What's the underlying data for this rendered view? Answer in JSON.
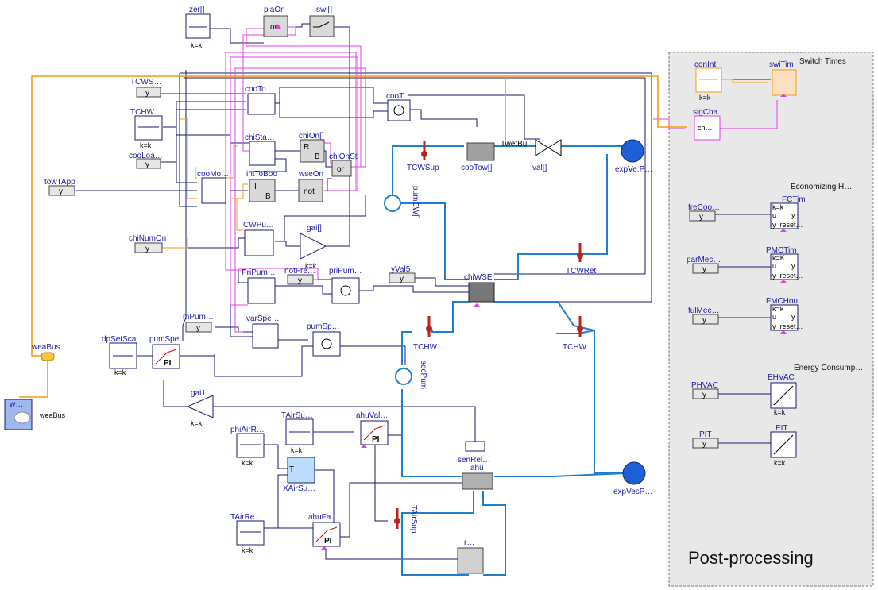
{
  "post_processing": {
    "title": "Post-processing",
    "section_switch": "Switch Times",
    "section_econ": "Economizing H…",
    "section_energy": "Energy Consump…"
  },
  "blocks": {
    "zer": {
      "name": "zer[]",
      "param": "k=k"
    },
    "plaOn": {
      "name": "plaOn",
      "inner": "or"
    },
    "swi": {
      "name": "swi[]"
    },
    "TCWS": {
      "name": "TCWS…",
      "inner": "y"
    },
    "TCHW": {
      "name": "TCHW…",
      "param": "k=k"
    },
    "cooLoa": {
      "name": "cooLoa…",
      "inner": "y"
    },
    "towTApp": {
      "name": "towTApp",
      "inner": "y"
    },
    "chiNumOn": {
      "name": "chiNumOn",
      "inner": "y"
    },
    "cooTo": {
      "name": "cooTo…"
    },
    "cooT": {
      "name": "cooT…"
    },
    "chiSta": {
      "name": "chiSta…"
    },
    "chiOn": {
      "name": "chiOn[]",
      "inner": "R",
      "inner2": "B"
    },
    "chiOnSt": {
      "name": "chiOnSt",
      "inner": "or"
    },
    "cooMo": {
      "name": "cooMo…"
    },
    "intToBoo": {
      "name": "intToBoo",
      "inner": "I",
      "inner2": "B"
    },
    "wseOn": {
      "name": "wseOn",
      "inner": "not"
    },
    "CWPu": {
      "name": "CWPu…"
    },
    "gai": {
      "name": "gai[]",
      "param": "k=k"
    },
    "PriPum": {
      "name": "PriPum…"
    },
    "notFre": {
      "name": "notFre…",
      "inner": "y"
    },
    "priPum": {
      "name": "priPum…"
    },
    "yVal5": {
      "name": "yVal5",
      "inner": "y"
    },
    "mPum": {
      "name": "mPum…",
      "inner": "y"
    },
    "varSpe": {
      "name": "varSpe…"
    },
    "pumSp": {
      "name": "pumSp…"
    },
    "dpSetSca": {
      "name": "dpSetSca",
      "param": "k=k"
    },
    "pumSpe": {
      "name": "pumSpe",
      "inner": "PI"
    },
    "weaBus": {
      "name": "weaBus"
    },
    "weaBus2": {
      "name": "weaBus"
    },
    "weather": {
      "name": "w…"
    },
    "gai1": {
      "name": "gai1",
      "param": "k=k"
    },
    "phiAirR": {
      "name": "phiAirR…",
      "param": "k=k"
    },
    "TAirSu": {
      "name": "TAirSu…",
      "param": "k=k"
    },
    "ahuVal": {
      "name": "ahuVal…",
      "inner": "PI"
    },
    "XAirSu": {
      "name": "XAirSu…",
      "inner": "T"
    },
    "TAirRe": {
      "name": "TAirRe…",
      "param": "k=k"
    },
    "ahuFa": {
      "name": "ahuFa…",
      "inner": "PI"
    },
    "TAirSup": {
      "name": "TAirSup"
    },
    "room": {
      "name": "r…"
    },
    "senRel": {
      "name": "senRel…"
    },
    "ahu": {
      "name": "ahu"
    },
    "expVesP": {
      "name": "expVesP…"
    },
    "expVeP": {
      "name": "expVe.P…"
    },
    "TCWSup": {
      "name": "TCWSup"
    },
    "cooTow": {
      "name": "cooTow[]"
    },
    "wetBu": {
      "name": "TwetBu"
    },
    "val": {
      "name": "val[]"
    },
    "pumCW": {
      "name": "pumCW[]"
    },
    "TCWRet": {
      "name": "TCWRet"
    },
    "chiWSE": {
      "name": "chiWSE"
    },
    "TCHWa": {
      "name": "TCHW…"
    },
    "TCHWb": {
      "name": "TCHW…"
    },
    "secPum": {
      "name": "secPum"
    },
    "conInt": {
      "name": "conInt",
      "param": "k=k"
    },
    "swiTim": {
      "name": "swiTim"
    },
    "sigCha": {
      "name": "sigCha",
      "inner": "ch…"
    },
    "freCoo": {
      "name": "freCoo…",
      "inner": "y"
    },
    "FCTim": {
      "name": "FCTim",
      "l1": "k=k",
      "l2": "u",
      "l3": "y_reset…",
      "out": "y"
    },
    "parMec": {
      "name": "parMec…",
      "inner": "y"
    },
    "PMCTim": {
      "name": "PMCTim",
      "l1": "k=K",
      "l2": "u",
      "l3": "y_reset…",
      "out": "y"
    },
    "fulMec": {
      "name": "fulMec…",
      "inner": "y"
    },
    "FMCHou": {
      "name": "FMCHou",
      "l1": "k=k",
      "l2": "u",
      "l3": "y_reset…",
      "out": "y"
    },
    "PHVAC": {
      "name": "PHVAC",
      "inner": "y"
    },
    "EHVAC": {
      "name": "EHVAC",
      "param": "k=k"
    },
    "PIT": {
      "name": "PIT",
      "inner": "y"
    },
    "EIT": {
      "name": "EIT",
      "param": "k=k"
    }
  },
  "colors": {
    "signal": "#1a1a6e",
    "water": "#1e7fd0",
    "bus": "#f39c12",
    "boolean": "#e040e0",
    "panel": "#e8e8e8"
  }
}
